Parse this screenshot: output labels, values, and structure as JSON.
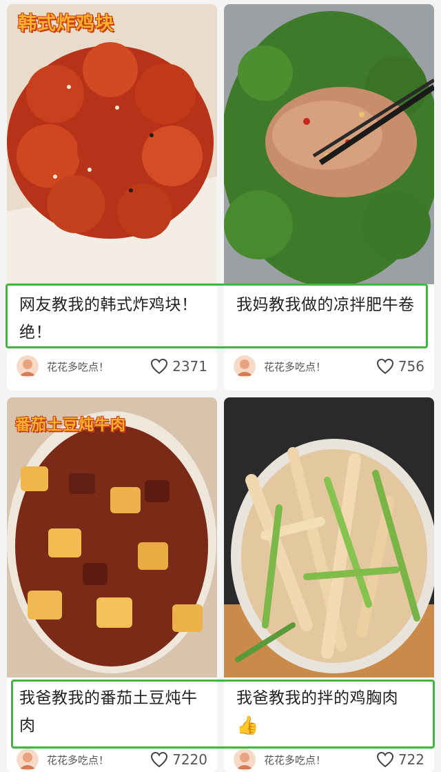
{
  "posts": [
    {
      "title": "网友教我的韩式炸鸡块！绝！",
      "overlay": "韩式炸鸡块",
      "author": "花花多吃点！",
      "likes": "2371"
    },
    {
      "title": "我妈教我做的凉拌肥牛卷",
      "overlay": "",
      "author": "花花多吃点！",
      "likes": "756"
    },
    {
      "title": "我爸教我的番茄土豆炖牛肉",
      "overlay": "番茄土豆炖牛肉",
      "author": "花花多吃点！",
      "likes": "7220"
    },
    {
      "title": "我爸教我的拌的鸡胸肉",
      "title_emoji": "👍",
      "overlay": "",
      "author": "花花多吃点！",
      "likes": "722"
    }
  ],
  "colors": {
    "highlight": "#3db83d",
    "overlay_text": "#ffb02e"
  },
  "icons": {
    "like": "heart-outline-icon",
    "avatar": "user-avatar-icon"
  }
}
